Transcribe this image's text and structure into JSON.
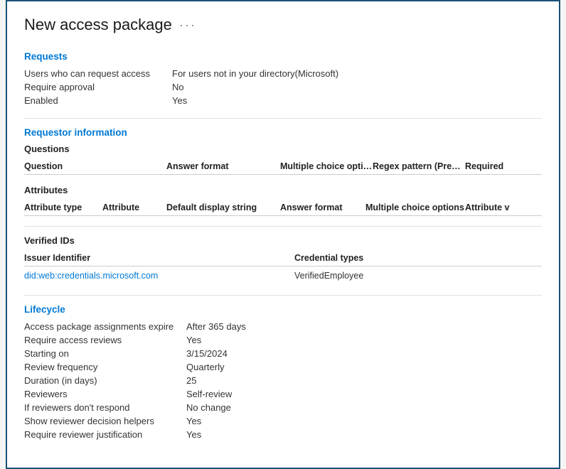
{
  "page": {
    "title": "New access package",
    "ellipsis": "···"
  },
  "sections": {
    "requests": {
      "title": "Requests",
      "fields": [
        {
          "label": "Users who can request access",
          "value": "For users not in your directory(Microsoft)"
        },
        {
          "label": "Require approval",
          "value": "No"
        },
        {
          "label": "Enabled",
          "value": "Yes"
        }
      ]
    },
    "requestor_info": {
      "title": "Requestor information",
      "questions": {
        "subtitle": "Questions",
        "headers": [
          "Question",
          "Answer format",
          "Multiple choice options",
          "Regex pattern (Preview)",
          "Required"
        ],
        "rows": []
      },
      "attributes": {
        "subtitle": "Attributes",
        "headers": [
          "Attribute type",
          "Attribute",
          "Default display string",
          "Answer format",
          "Multiple choice options",
          "Attribute v"
        ],
        "rows": []
      }
    },
    "verified_ids": {
      "title": "Verified IDs",
      "headers": [
        "Issuer Identifier",
        "Credential types"
      ],
      "rows": [
        {
          "issuer": "did:web:credentials.microsoft.com",
          "cred": "VerifiedEmployee"
        }
      ]
    },
    "lifecycle": {
      "title": "Lifecycle",
      "fields": [
        {
          "label": "Access package assignments expire",
          "value": "After 365 days"
        },
        {
          "label": "Require access reviews",
          "value": "Yes"
        },
        {
          "label": "Starting on",
          "value": "3/15/2024"
        },
        {
          "label": "Review frequency",
          "value": "Quarterly"
        },
        {
          "label": "Duration (in days)",
          "value": "25"
        },
        {
          "label": "Reviewers",
          "value": "Self-review"
        },
        {
          "label": "If reviewers don't respond",
          "value": "No change"
        },
        {
          "label": "Show reviewer decision helpers",
          "value": "Yes"
        },
        {
          "label": "Require reviewer justification",
          "value": "Yes"
        }
      ]
    }
  }
}
